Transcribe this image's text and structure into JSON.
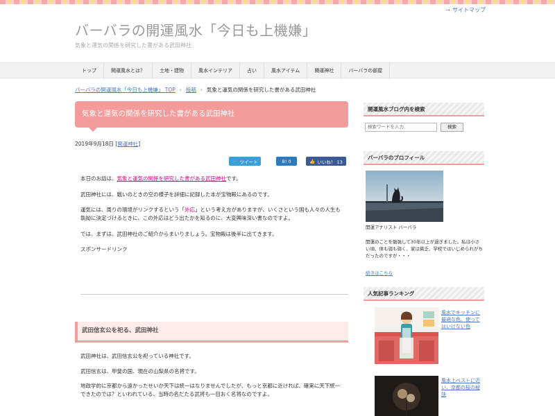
{
  "header": {
    "sitemap_label": "サイトマップ",
    "title": "バーバラの開運風水「今日も上機嫌」",
    "description": "気象と運気の関係を研究した書がある武田神社"
  },
  "nav": {
    "items": [
      {
        "label": "トップ"
      },
      {
        "label": "開運風水とは？"
      },
      {
        "label": "土地・建物"
      },
      {
        "label": "風水インテリア"
      },
      {
        "label": "占い"
      },
      {
        "label": "風水アイテム"
      },
      {
        "label": "開運神社"
      },
      {
        "label": "バーバラの部屋"
      }
    ]
  },
  "breadcrumb": {
    "home": "バーバラの開運風水「今日も上機嫌」 TOP",
    "category": "投稿",
    "current": "気象と運気の関係を研究した書がある武田神社"
  },
  "post": {
    "title": "気象と運気の関係を研究した書がある武田神社",
    "date": "2019年9月18日",
    "category_label": "開運神社",
    "share": {
      "tweet": "ツイート",
      "hatena": "B! 0",
      "like": "いいね！ 13"
    },
    "intro_prefix": "本日のお話は、",
    "intro_highlight": "気象と運気の関係を研究した書がある武田神社",
    "intro_suffix": "です。",
    "p2": "武田神社には、戦いのときの空の様子を詳細に記録した本が宝物殿にあるのです。",
    "p3_prefix": "運気には、周りの環境がリンクするという「",
    "p3_highlight": "外応",
    "p3_suffix": "」という考え方がありますが、いくさという国も人々の人生も執拗に決定づけるときに、この外応はどう出たかを知るのに、大変興味深い書なのですよ。",
    "p4": "では、まずは、武田神社のご紹介からまいりましょう。宝物殿は後半に出てきます。",
    "sponsor": "スポンサードリンク",
    "h2": "武田信玄公を祀る、武田神社",
    "s1": "武田神社は、武田信玄公を祀っている神社です。",
    "s2": "武田信玄は、甲斐の国、現在の山梨県の名将です。",
    "s3": "地政学的に京都から遠かったせいか天下は統一はなりませんでしたが、もっと京都に近ければ、確実に天下統一できたのでは？といわれている、当時の名だたる武将も一目おく名将なのですよ。"
  },
  "sidebar": {
    "search_head": "開運風水ブログ内を検索",
    "search_placeholder": "検索ワードを入力",
    "search_button": "検索",
    "profile_head": "バーバラのプロフィール",
    "profile_name": "開運アナリスト バーバラ",
    "profile_text": "開運のことを勉強して30年以上が過ぎました。私は小さい頃、体も弱も弱く、家は貧乏、学校ではいじめられがちだったのですが・・・",
    "profile_more": "続きはこちら",
    "ranking_head": "人気記事ランキング",
    "ranking": [
      {
        "title": "風水でキッチンに最適な色、使ってはいけない色"
      },
      {
        "title": "風水上ベストに近い、京都の桜の秘訣"
      }
    ]
  },
  "colors": {
    "accent": "#f49b9b",
    "link": "#4a78c2",
    "highlight": "#e4007f"
  }
}
